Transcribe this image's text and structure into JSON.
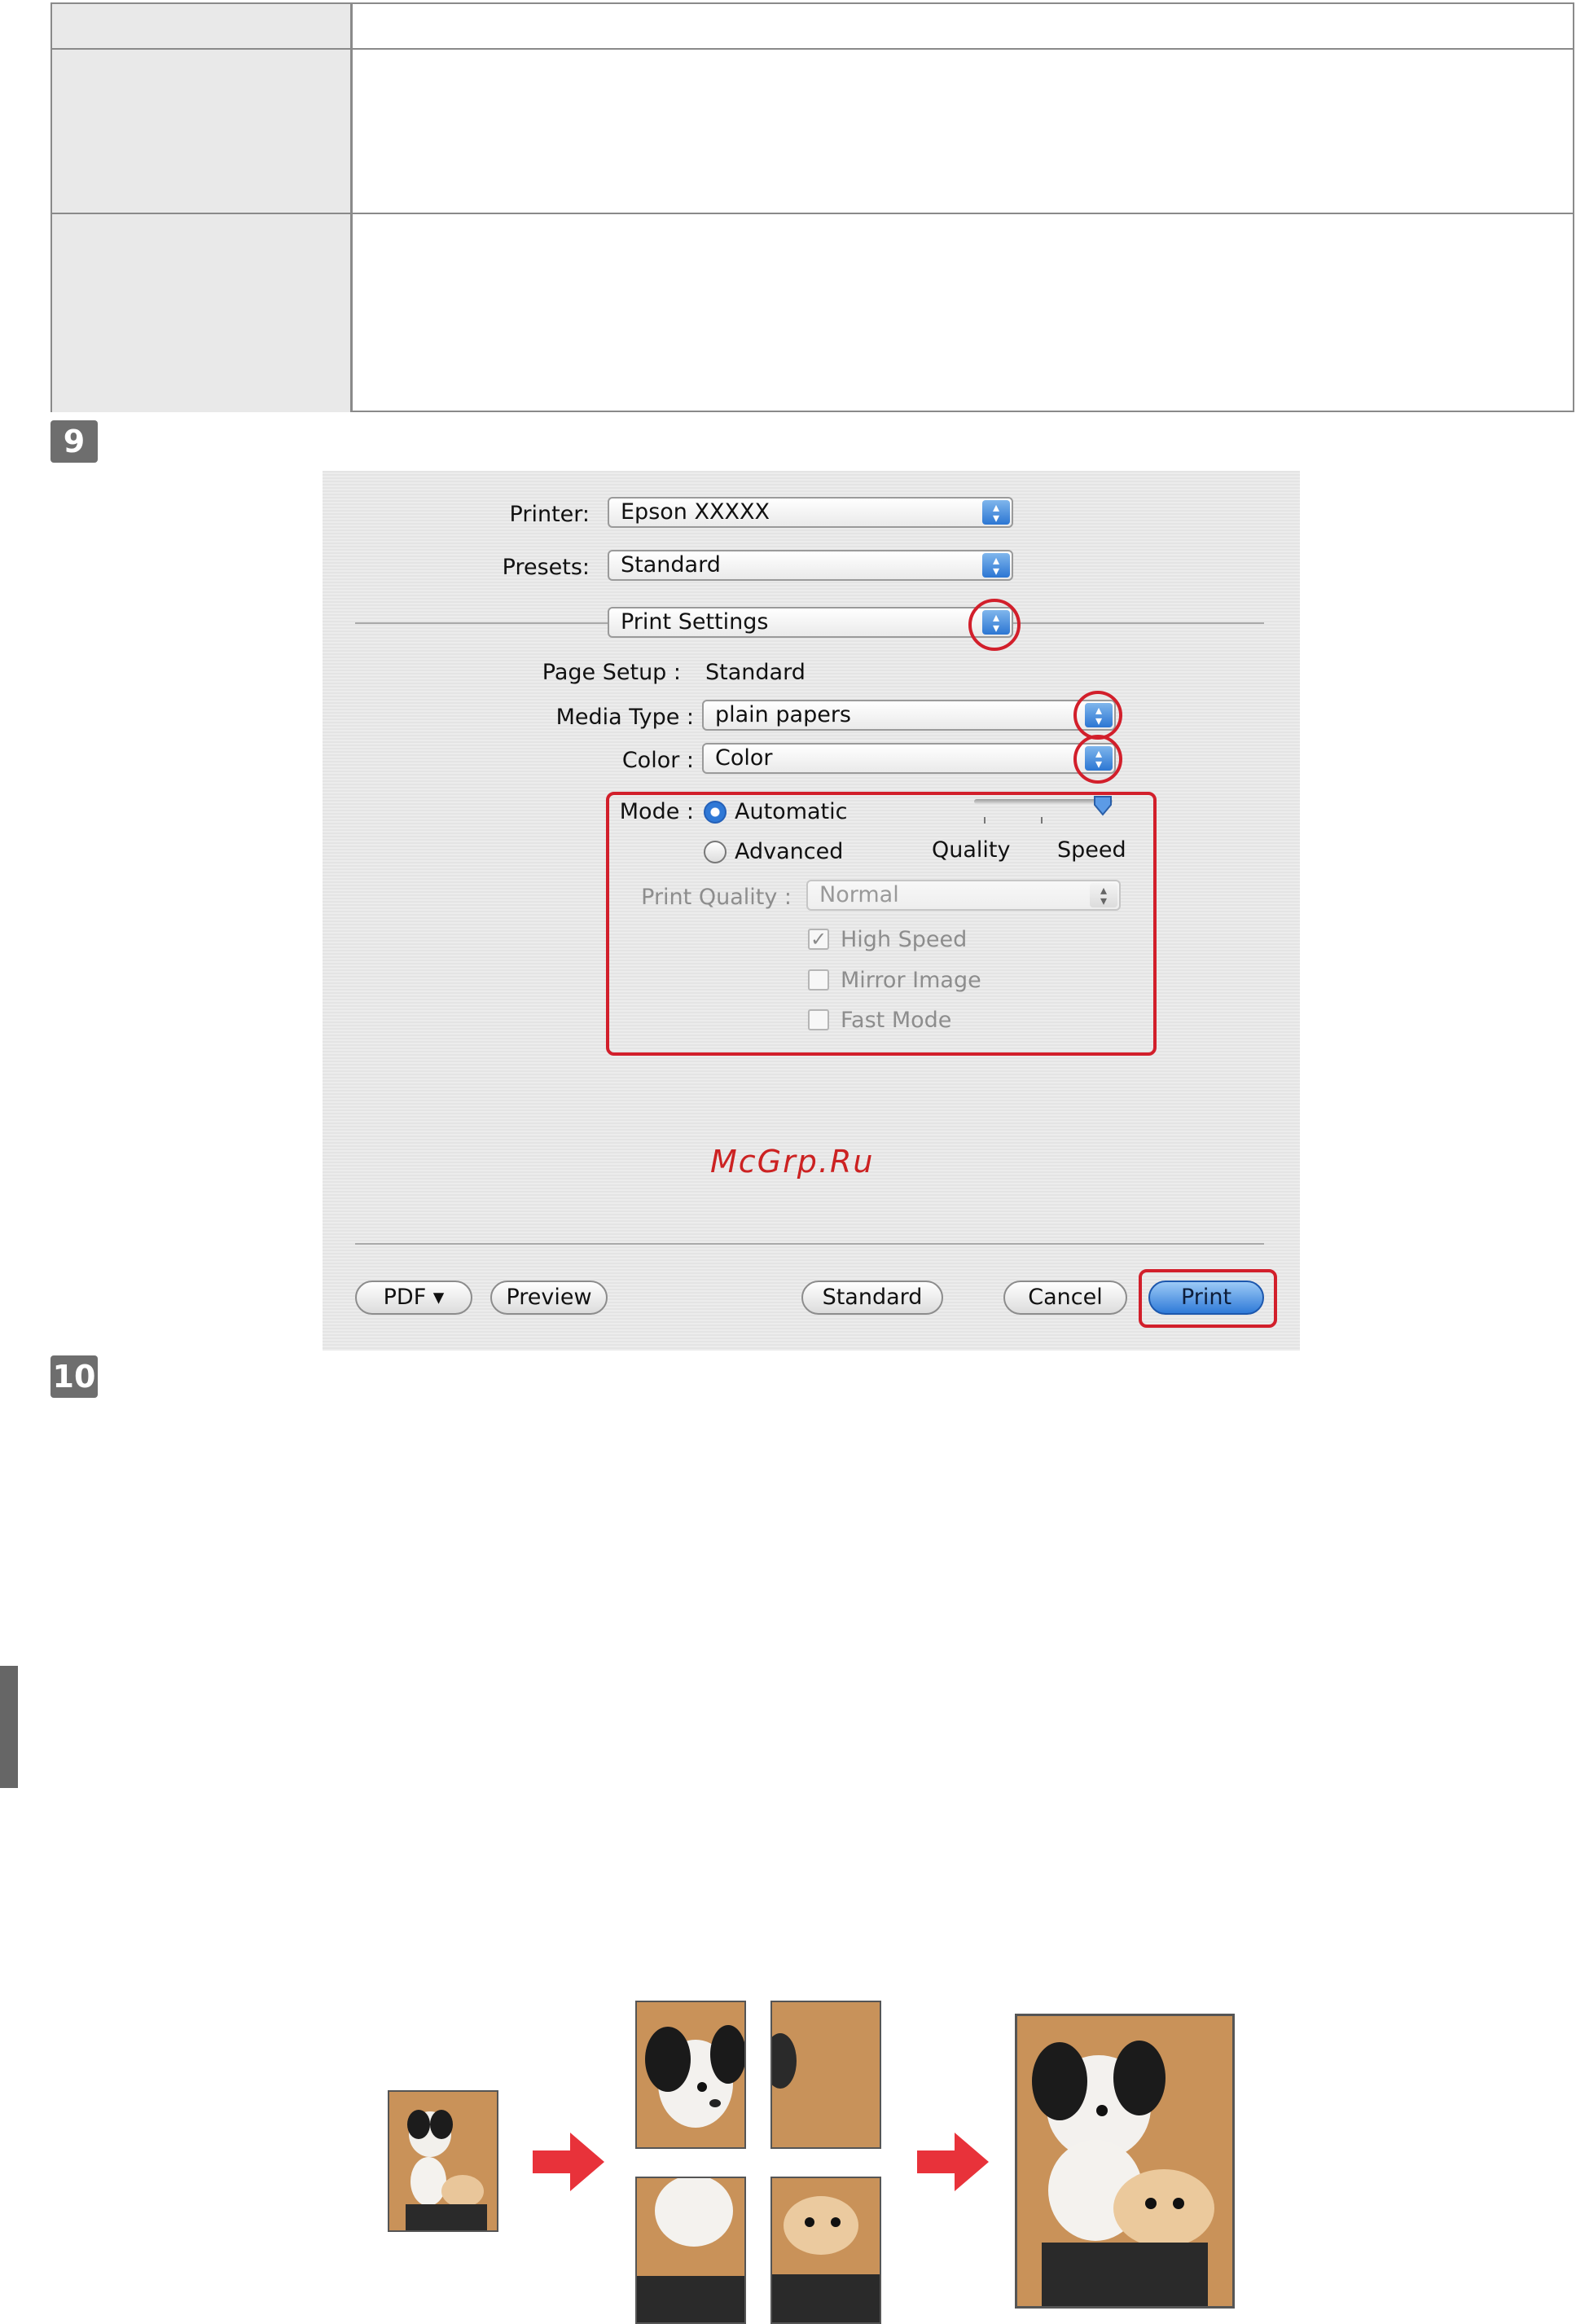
{
  "steps": {
    "step9": "9",
    "step10": "10"
  },
  "dialog": {
    "printer_label": "Printer:",
    "printer_value": "Epson XXXXX",
    "presets_label": "Presets:",
    "presets_value": "Standard",
    "panel_value": "Print Settings",
    "page_setup_label": "Page Setup :",
    "page_setup_value": "Standard",
    "media_type_label": "Media Type :",
    "media_type_value": "plain papers",
    "color_label": "Color :",
    "color_value": "Color",
    "mode_label": "Mode :",
    "mode_automatic": "Automatic",
    "mode_advanced": "Advanced",
    "slider_quality": "Quality",
    "slider_speed": "Speed",
    "slider_level": 1.0,
    "print_quality_label": "Print Quality :",
    "print_quality_value": "Normal",
    "high_speed": "High Speed",
    "mirror_image": "Mirror Image",
    "fast_mode": "Fast Mode",
    "watermark": "McGrp.Ru",
    "pdf_button": "PDF ▾",
    "preview_button": "Preview",
    "standard_button": "Standard",
    "cancel_button": "Cancel",
    "print_button": "Print",
    "highlight_color": "#d21f2b",
    "accent_color": "#2f7ad8"
  }
}
